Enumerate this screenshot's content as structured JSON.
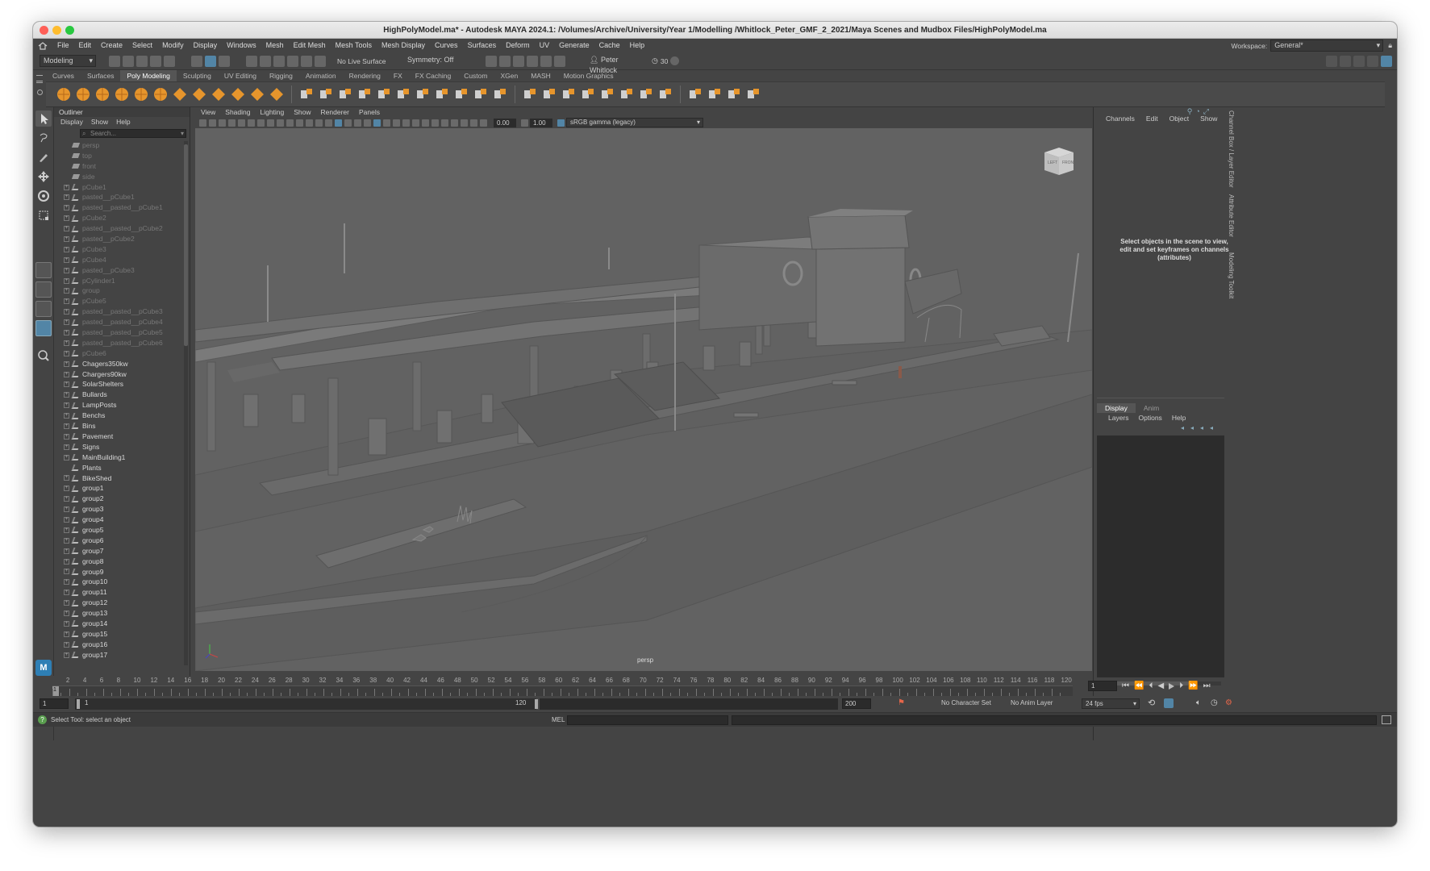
{
  "window": {
    "title": "HighPolyModel.ma* - Autodesk MAYA 2024.1: /Volumes/Archive/University/Year 1/Modelling /Whitlock_Peter_GMF_2_2021/Maya Scenes and Mudbox Files/HighPolyModel.ma"
  },
  "menu": [
    "File",
    "Edit",
    "Create",
    "Select",
    "Modify",
    "Display",
    "Windows",
    "Mesh",
    "Edit Mesh",
    "Mesh Tools",
    "Mesh Display",
    "Curves",
    "Surfaces",
    "Deform",
    "UV",
    "Generate",
    "Cache",
    "Help"
  ],
  "workspace": {
    "label": "Workspace:",
    "value": "General*"
  },
  "statusline": {
    "mode": "Modeling",
    "live_surface": "No Live Surface",
    "symmetry": "Symmetry: Off",
    "user": "Peter Whitlock",
    "counter": "30"
  },
  "shelf_tabs": [
    "Curves",
    "Surfaces",
    "Poly Modeling",
    "Sculpting",
    "UV Editing",
    "Rigging",
    "Animation",
    "Rendering",
    "FX",
    "FX Caching",
    "Custom",
    "XGen",
    "MASH",
    "Motion Graphics"
  ],
  "shelf_active": "Poly Modeling",
  "outliner": {
    "title": "Outliner",
    "menu": [
      "Display",
      "Show",
      "Help"
    ],
    "search_placeholder": "Search...",
    "items": [
      {
        "label": "persp",
        "cam": true,
        "dim": true
      },
      {
        "label": "top",
        "cam": true,
        "dim": true
      },
      {
        "label": "front",
        "cam": true,
        "dim": true
      },
      {
        "label": "side",
        "cam": true,
        "dim": true
      },
      {
        "label": "pCube1",
        "dim": true
      },
      {
        "label": "pasted__pCube1",
        "dim": true
      },
      {
        "label": "pasted__pasted__pCube1",
        "dim": true
      },
      {
        "label": "pCube2",
        "dim": true
      },
      {
        "label": "pasted__pasted__pCube2",
        "dim": true
      },
      {
        "label": "pasted__pCube2",
        "dim": true
      },
      {
        "label": "pCube3",
        "dim": true
      },
      {
        "label": "pCube4",
        "dim": true
      },
      {
        "label": "pasted__pCube3",
        "dim": true
      },
      {
        "label": "pCylinder1",
        "dim": true
      },
      {
        "label": "group",
        "dim": true
      },
      {
        "label": "pCube5",
        "dim": true
      },
      {
        "label": "pasted__pasted__pCube3",
        "dim": true
      },
      {
        "label": "pasted__pasted__pCube4",
        "dim": true
      },
      {
        "label": "pasted__pasted__pCube5",
        "dim": true
      },
      {
        "label": "pasted__pasted__pCube6",
        "dim": true
      },
      {
        "label": "pCube6",
        "dim": true
      },
      {
        "label": "Chagers350kw"
      },
      {
        "label": "Chargers90kw"
      },
      {
        "label": "SolarShelters"
      },
      {
        "label": "Bullards"
      },
      {
        "label": "LampPosts"
      },
      {
        "label": "Benchs"
      },
      {
        "label": "Bins"
      },
      {
        "label": "Pavement"
      },
      {
        "label": "Signs"
      },
      {
        "label": "MainBuilding1"
      },
      {
        "label": "Plants",
        "noexp": true
      },
      {
        "label": "BikeShed"
      },
      {
        "label": "group1"
      },
      {
        "label": "group2"
      },
      {
        "label": "group3"
      },
      {
        "label": "group4"
      },
      {
        "label": "group5"
      },
      {
        "label": "group6"
      },
      {
        "label": "group7"
      },
      {
        "label": "group8"
      },
      {
        "label": "group9"
      },
      {
        "label": "group10"
      },
      {
        "label": "group11"
      },
      {
        "label": "group12"
      },
      {
        "label": "group13"
      },
      {
        "label": "group14"
      },
      {
        "label": "group15"
      },
      {
        "label": "group16"
      },
      {
        "label": "group17"
      }
    ]
  },
  "viewport": {
    "menu": [
      "View",
      "Shading",
      "Lighting",
      "Show",
      "Renderer",
      "Panels"
    ],
    "field1": "0.00",
    "field2": "1.00",
    "colorspace": "sRGB gamma (legacy)",
    "camera_label": "persp",
    "viewcube_left": "LEFT",
    "viewcube_front": "FRONT"
  },
  "channelbox": {
    "menu": [
      "Channels",
      "Edit",
      "Object",
      "Show"
    ],
    "empty_message": "Select objects in the scene to view, edit and set keyframes on channels (attributes)",
    "side_tabs": [
      "Channel Box / Layer Editor",
      "Attribute Editor",
      "Modeling Toolkit"
    ]
  },
  "layers": {
    "tabs": [
      "Display",
      "Anim"
    ],
    "menu": [
      "Layers",
      "Options",
      "Help"
    ]
  },
  "timeline": {
    "ticks": [
      "2",
      "4",
      "6",
      "8",
      "10",
      "12",
      "14",
      "16",
      "18",
      "20",
      "22",
      "24",
      "26",
      "28",
      "30",
      "32",
      "34",
      "36",
      "38",
      "40",
      "42",
      "44",
      "46",
      "48",
      "50",
      "52",
      "54",
      "56",
      "58",
      "60",
      "62",
      "64",
      "66",
      "68",
      "70",
      "72",
      "74",
      "76",
      "78",
      "80",
      "82",
      "84",
      "86",
      "88",
      "90",
      "92",
      "94",
      "96",
      "98",
      "100",
      "102",
      "104",
      "106",
      "108",
      "110",
      "112",
      "114",
      "116",
      "118",
      "120"
    ],
    "current_frame": "1",
    "current_marker": "1"
  },
  "range": {
    "start": "1",
    "inner_start": "1",
    "inner_end": "120",
    "end": "200",
    "character_set": "No Character Set",
    "anim_layer": "No Anim Layer",
    "fps": "24 fps"
  },
  "command": {
    "help_text": "Select Tool: select an object",
    "lang": "MEL"
  },
  "colors": {
    "accent": "#5285a6",
    "shelf_orange": "#e6952c",
    "bg": "#444444",
    "viewport": "#626262"
  }
}
